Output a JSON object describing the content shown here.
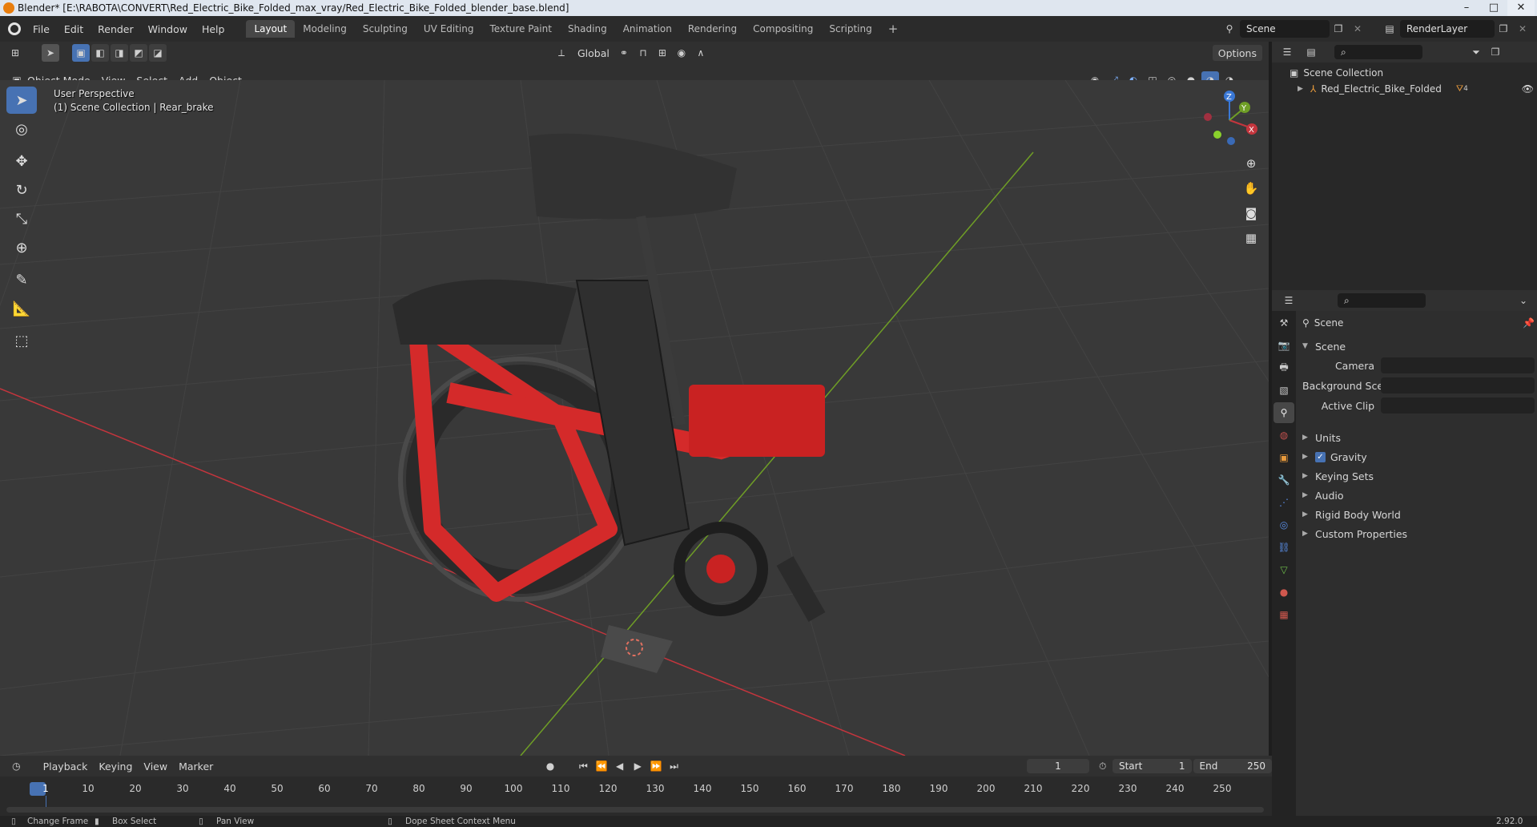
{
  "window": {
    "title": "Blender* [E:\\RABOTA\\CONVERT\\Red_Electric_Bike_Folded_max_vray/Red_Electric_Bike_Folded_blender_base.blend]",
    "minimize": "–",
    "maximize": "□",
    "close": "✕"
  },
  "menu": {
    "items": [
      "File",
      "Edit",
      "Render",
      "Window",
      "Help"
    ],
    "workspaces": [
      "Layout",
      "Modeling",
      "Sculpting",
      "UV Editing",
      "Texture Paint",
      "Shading",
      "Animation",
      "Rendering",
      "Compositing",
      "Scripting"
    ],
    "add_workspace": "+",
    "scene_field": "Scene",
    "render_layer_field": "RenderLayer"
  },
  "viewport_header": {
    "orientation": "Global",
    "options": "Options",
    "mode": "Object Mode",
    "menus": [
      "View",
      "Select",
      "Add",
      "Object"
    ]
  },
  "viewport": {
    "perspective_label": "User Perspective",
    "collection_label": "(1) Scene Collection | Rear_brake",
    "gizmo": {
      "x": "X",
      "y": "Y",
      "z": "Z"
    },
    "colors": {
      "bg": "#393939",
      "grid": "#464646",
      "x_axis": "#c4353d",
      "y_axis": "#6f9e26",
      "bike_red": "#d42a2a"
    }
  },
  "outliner": {
    "root": "Scene Collection",
    "items": [
      {
        "label": "Red_Electric_Bike_Folded",
        "badge": "4"
      }
    ]
  },
  "properties": {
    "header": "Scene",
    "panel": "Scene",
    "fields": [
      {
        "label": "Camera",
        "value": ""
      },
      {
        "label": "Background Scene",
        "value": ""
      },
      {
        "label": "Active Clip",
        "value": ""
      }
    ],
    "subpanels": [
      "Units",
      "Gravity",
      "Keying Sets",
      "Audio",
      "Rigid Body World",
      "Custom Properties"
    ],
    "gravity_checked": true
  },
  "timeline": {
    "menus": [
      "Playback",
      "Keying",
      "View",
      "Marker"
    ],
    "current_frame": "1",
    "start_label": "Start",
    "start": "1",
    "end_label": "End",
    "end": "250",
    "ruler": [
      "1",
      "10",
      "20",
      "30",
      "40",
      "50",
      "60",
      "70",
      "80",
      "90",
      "100",
      "110",
      "120",
      "130",
      "140",
      "150",
      "160",
      "170",
      "180",
      "190",
      "200",
      "210",
      "220",
      "230",
      "240",
      "250"
    ]
  },
  "statusbar": {
    "items": [
      "Change Frame",
      "Box Select",
      "Pan View",
      "Dope Sheet Context Menu"
    ],
    "version": "2.92.0"
  }
}
